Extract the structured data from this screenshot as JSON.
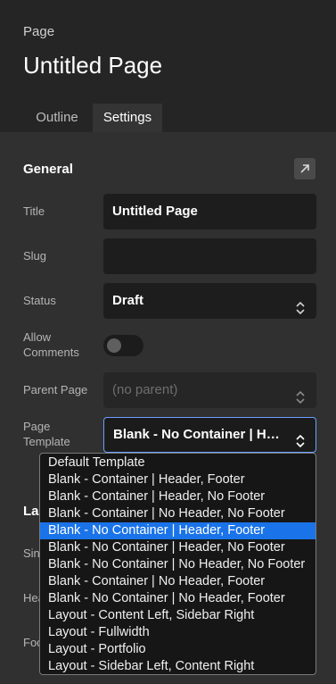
{
  "header": {
    "crumb": "Page",
    "title": "Untitled Page"
  },
  "tabs": [
    {
      "label": "Outline"
    },
    {
      "label": "Settings"
    }
  ],
  "general": {
    "heading": "General",
    "title_label": "Title",
    "title_value": "Untitled Page",
    "slug_label": "Slug",
    "slug_value": "",
    "status_label": "Status",
    "status_value": "Draft",
    "comments_label": "Allow Comments",
    "comments_on": false,
    "parent_label": "Parent Page",
    "parent_value": "(no parent)",
    "template_label": "Page Template",
    "template_value": "Blank - No Container | Header, Footer"
  },
  "layout": {
    "heading_partial": "La",
    "row1_partial": "Sin",
    "row2_partial": "Hea",
    "row3_partial": "Foo"
  },
  "template_options": [
    "Default Template",
    "Blank - Container | Header, Footer",
    "Blank - Container | Header, No Footer",
    "Blank - Container | No Header, No Footer",
    "Blank - No Container | Header, Footer",
    "Blank - No Container | Header, No Footer",
    "Blank - No Container | No Header, No Footer",
    "Blank - Container | No Header, Footer",
    "Blank - No Container | No Header, Footer",
    "Layout - Content Left, Sidebar Right",
    "Layout - Fullwidth",
    "Layout - Portfolio",
    "Layout - Sidebar Left, Content Right"
  ],
  "selected_option_index": 4,
  "colors": {
    "accent": "#1a73e8",
    "focus_border": "#6aa0ff",
    "panel": "#303030",
    "header": "#252525"
  }
}
